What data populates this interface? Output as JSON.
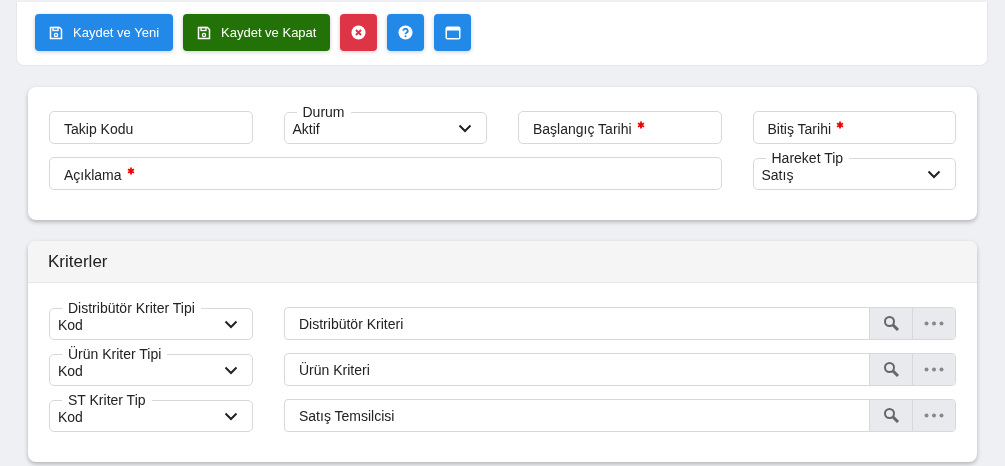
{
  "toolbar": {
    "buttons": [
      {
        "kind": "save",
        "label": "Kaydet ve Yeni",
        "color": "#2389e8"
      },
      {
        "kind": "save",
        "label": "Kaydet ve Kapat",
        "color": "#237207"
      },
      {
        "kind": "cancel",
        "color": "#dd3545"
      },
      {
        "kind": "help",
        "color": "#2389e8"
      },
      {
        "kind": "window",
        "color": "#2389e8"
      }
    ]
  },
  "form": {
    "fields": [
      {
        "kind": "text",
        "label": "Takip Kodu",
        "required": false
      },
      {
        "kind": "select",
        "label": "Durum",
        "value": "Aktif"
      },
      {
        "kind": "text",
        "label": "Başlangıç Tarihi",
        "required": true
      },
      {
        "kind": "text",
        "label": "Bitiş Tarihi",
        "required": true
      },
      {
        "kind": "wide",
        "label": "Açıklama",
        "required": true
      },
      {
        "kind": "select",
        "label": "Hareket Tip",
        "value": "Satış"
      }
    ]
  },
  "criteria": {
    "title": "Kriterler",
    "rows": [
      {
        "type_select": {
          "label": "Distribütör Kriter Tipi",
          "value": "Kod"
        },
        "lookup": {
          "label": "Distribütör Kriteri"
        }
      },
      {
        "type_select": {
          "label": "Ürün Kriter Tipi",
          "value": "Kod"
        },
        "lookup": {
          "label": "Ürün Kriteri"
        }
      },
      {
        "type_select": {
          "label": "ST Kriter Tip",
          "value": "Kod"
        },
        "lookup": {
          "label": "Satış Temsilcisi"
        }
      }
    ]
  }
}
